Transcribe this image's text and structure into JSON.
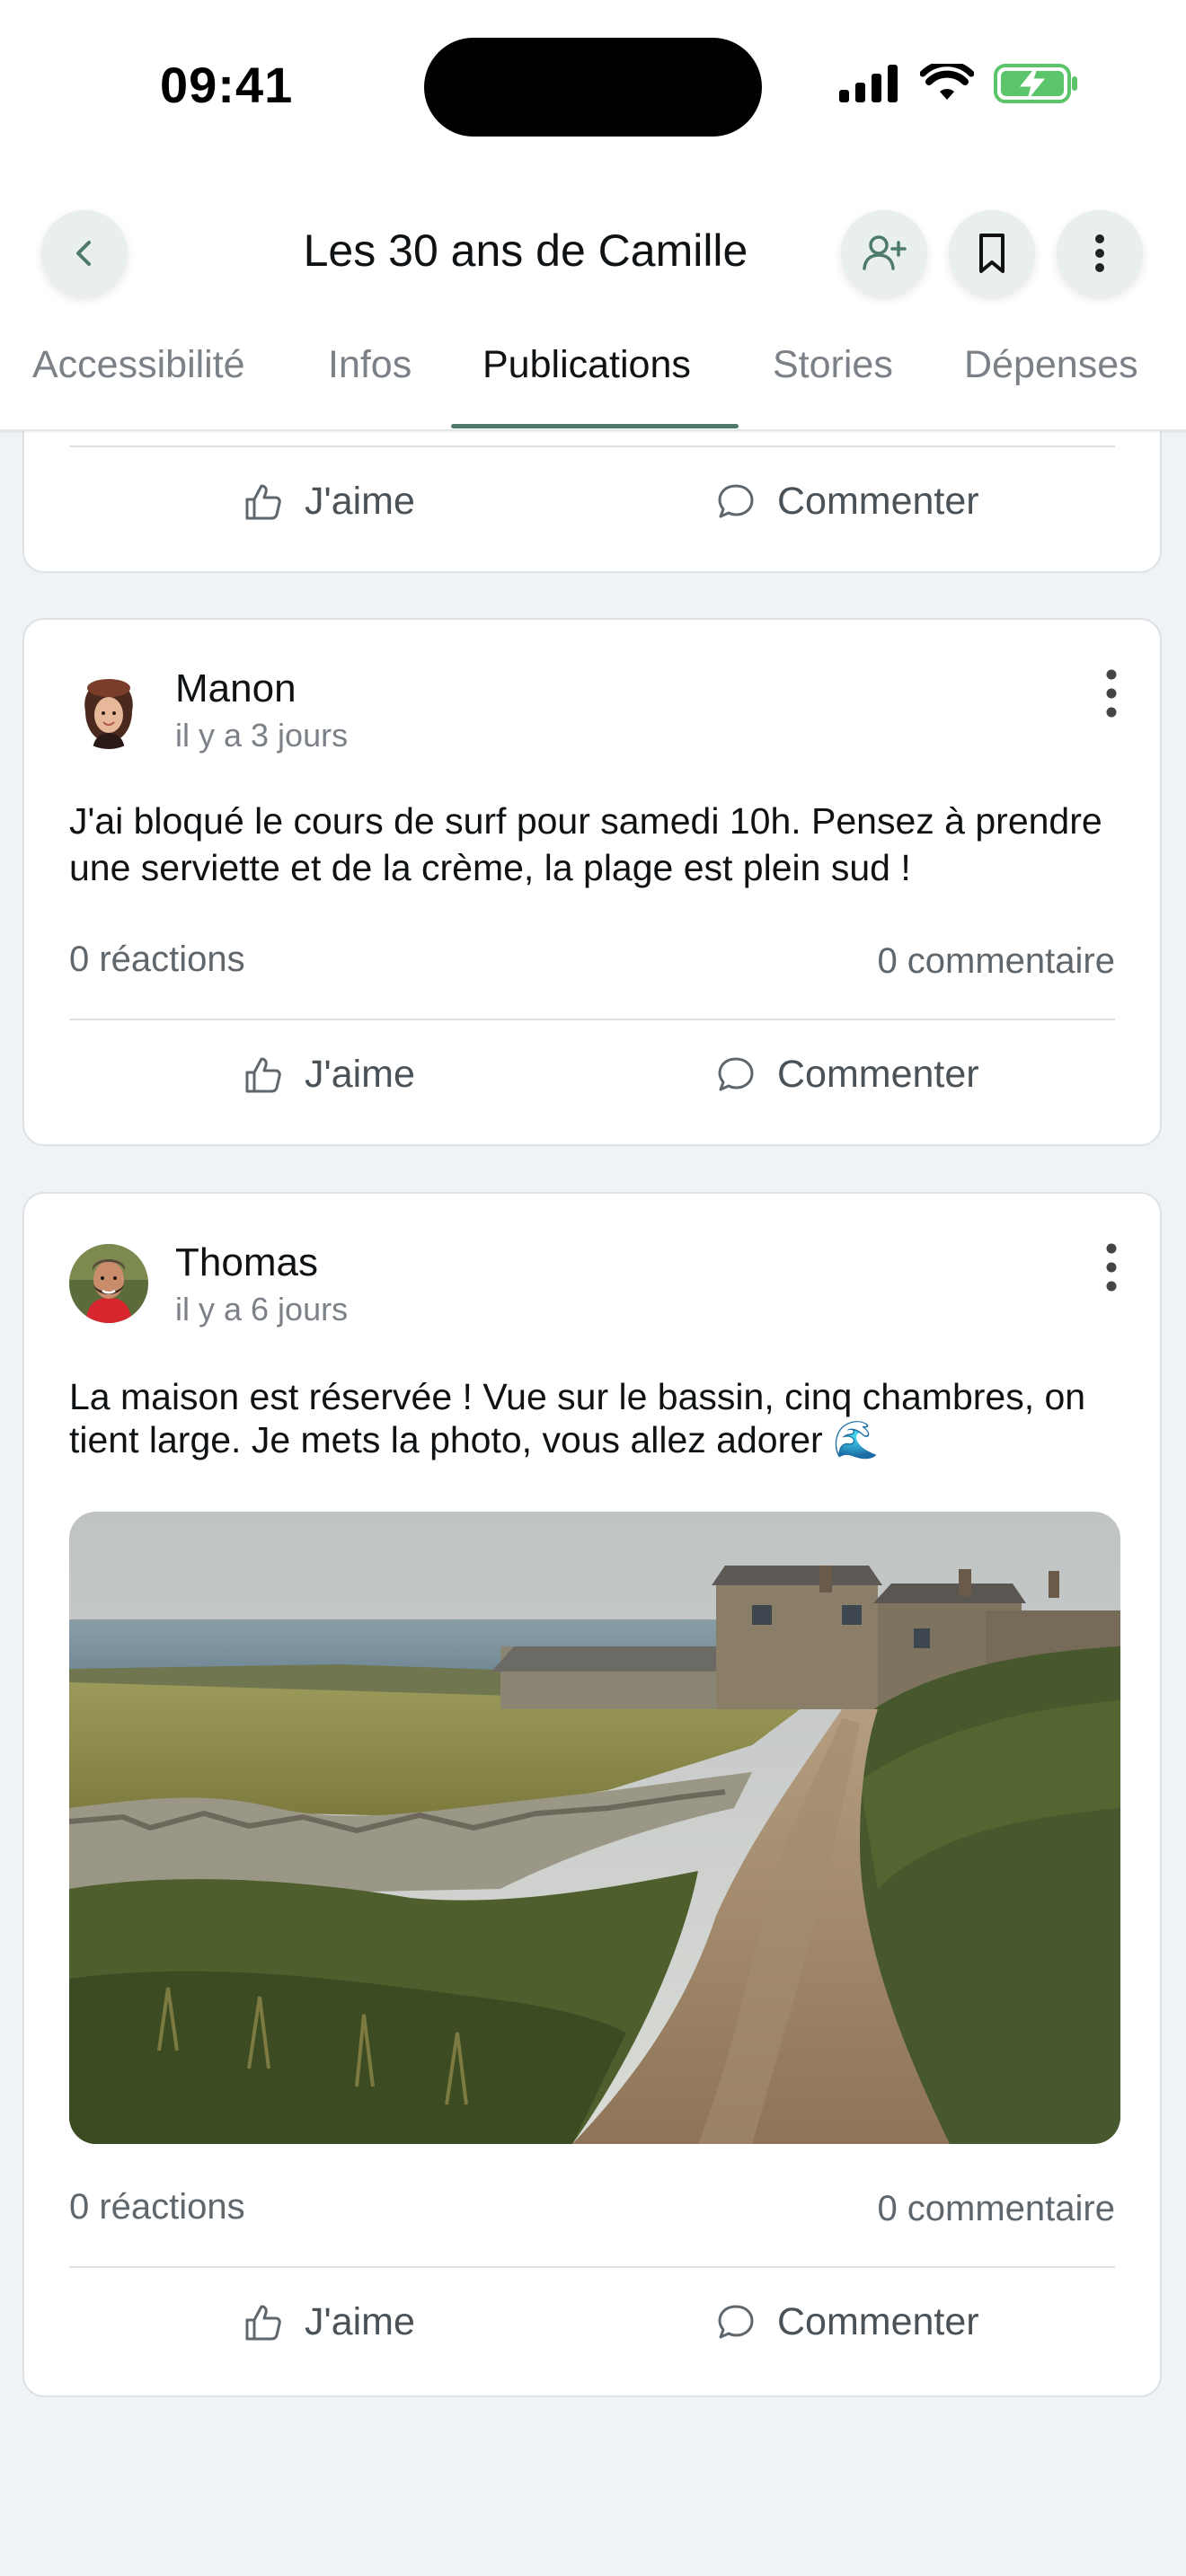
{
  "status_bar": {
    "time": "09:41",
    "icons": [
      "signal-icon",
      "wifi-icon",
      "battery-charging-icon"
    ]
  },
  "nav": {
    "title": "Les 30 ans de Camille",
    "icons": [
      "back-chevron-icon",
      "add-user-icon",
      "bookmark-icon",
      "more-vertical-icon"
    ]
  },
  "tabs": [
    {
      "label": "Accessibilité"
    },
    {
      "label": "Infos"
    },
    {
      "label": "Publications"
    },
    {
      "label": "Stories"
    },
    {
      "label": "Dépenses"
    }
  ],
  "active_tab": "Publications",
  "actions": {
    "like": "J'aime",
    "comment": "Commenter"
  },
  "posts": [
    {
      "author": "Manon",
      "time": "il y a 3 jours",
      "text": "J'ai bloqué le cours de surf pour samedi 10h. Pensez à prendre une serviette et de la crème, la plage est plein sud !",
      "reactions": "0 réactions",
      "comments": "0 commentaire"
    },
    {
      "author": "Thomas",
      "time": "il y a 6 jours",
      "text": "La maison est réservée ! Vue sur le bassin, cinq chambres, on tient large. Je mets la photo, vous allez adorer 🌊",
      "reactions": "0 réactions",
      "comments": "0 commentaire",
      "image": "coastal-village-path-photo"
    }
  ],
  "colors": {
    "accent": "#4d7a6b",
    "background": "#eff3f6",
    "card": "#ffffff",
    "muted_text": "#7b8187"
  }
}
